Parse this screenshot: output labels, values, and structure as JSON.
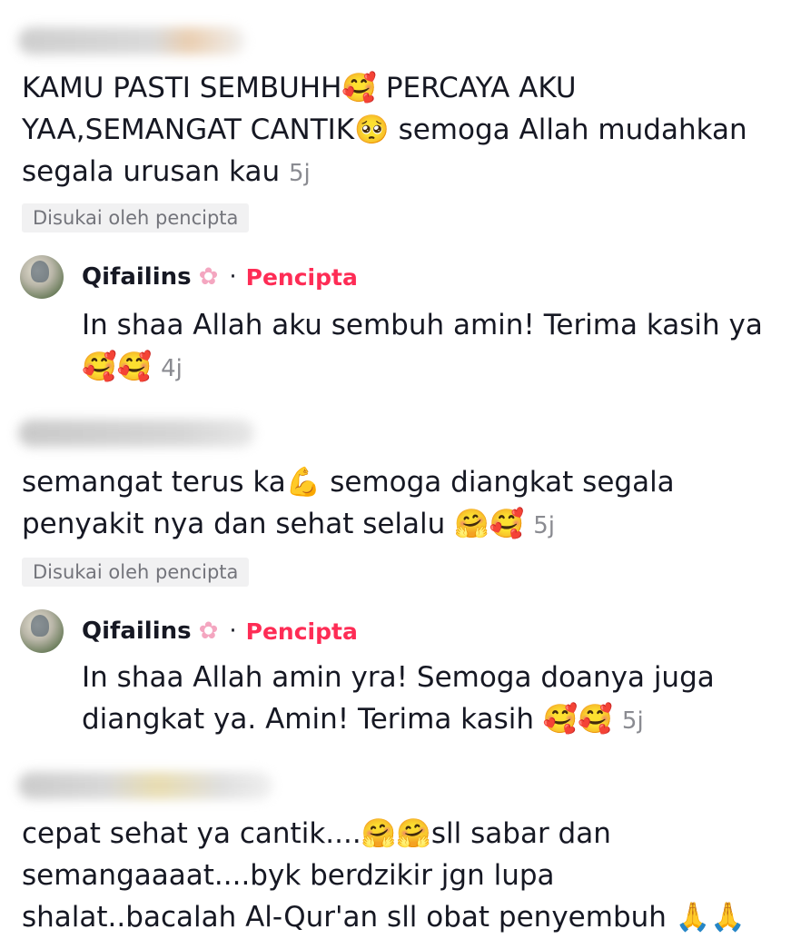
{
  "colors": {
    "accent": "#fe2c55",
    "muted": "#8a8b91",
    "badge_bg": "#f1f1f2",
    "text": "#161823"
  },
  "comments": [
    {
      "text": "KAMU PASTI SEMBUHH🥰 PERCAYA AKU YAA,SEMANGAT CANTIK🥺 semoga Allah mudahkan segala urusan kau",
      "time": "5j",
      "liked_badge": "Disukai oleh pencipta",
      "reply": {
        "username": "Qifailins",
        "username_icon": "cherry-blossom-icon",
        "separator": "·",
        "creator_label": "Pencipta",
        "text": "In shaa Allah aku sembuh amin! Terima kasih ya 🥰🥰",
        "time": "4j"
      }
    },
    {
      "text": "semangat terus ka💪 semoga diangkat segala penyakit nya dan sehat selalu 🤗🥰",
      "time": "5j",
      "liked_badge": "Disukai oleh pencipta",
      "reply": {
        "username": "Qifailins",
        "username_icon": "cherry-blossom-icon",
        "separator": "·",
        "creator_label": "Pencipta",
        "text": "In shaa Allah amin yra! Semoga doanya juga diangkat ya. Amin! Terima kasih 🥰🥰",
        "time": "5j"
      }
    },
    {
      "text": "cepat sehat ya cantik....🤗🤗sll sabar dan semangaaaat....byk berdzikir jgn lupa shalat..bacalah Al-Qur'an sll obat penyembuh 🙏🙏"
    }
  ]
}
